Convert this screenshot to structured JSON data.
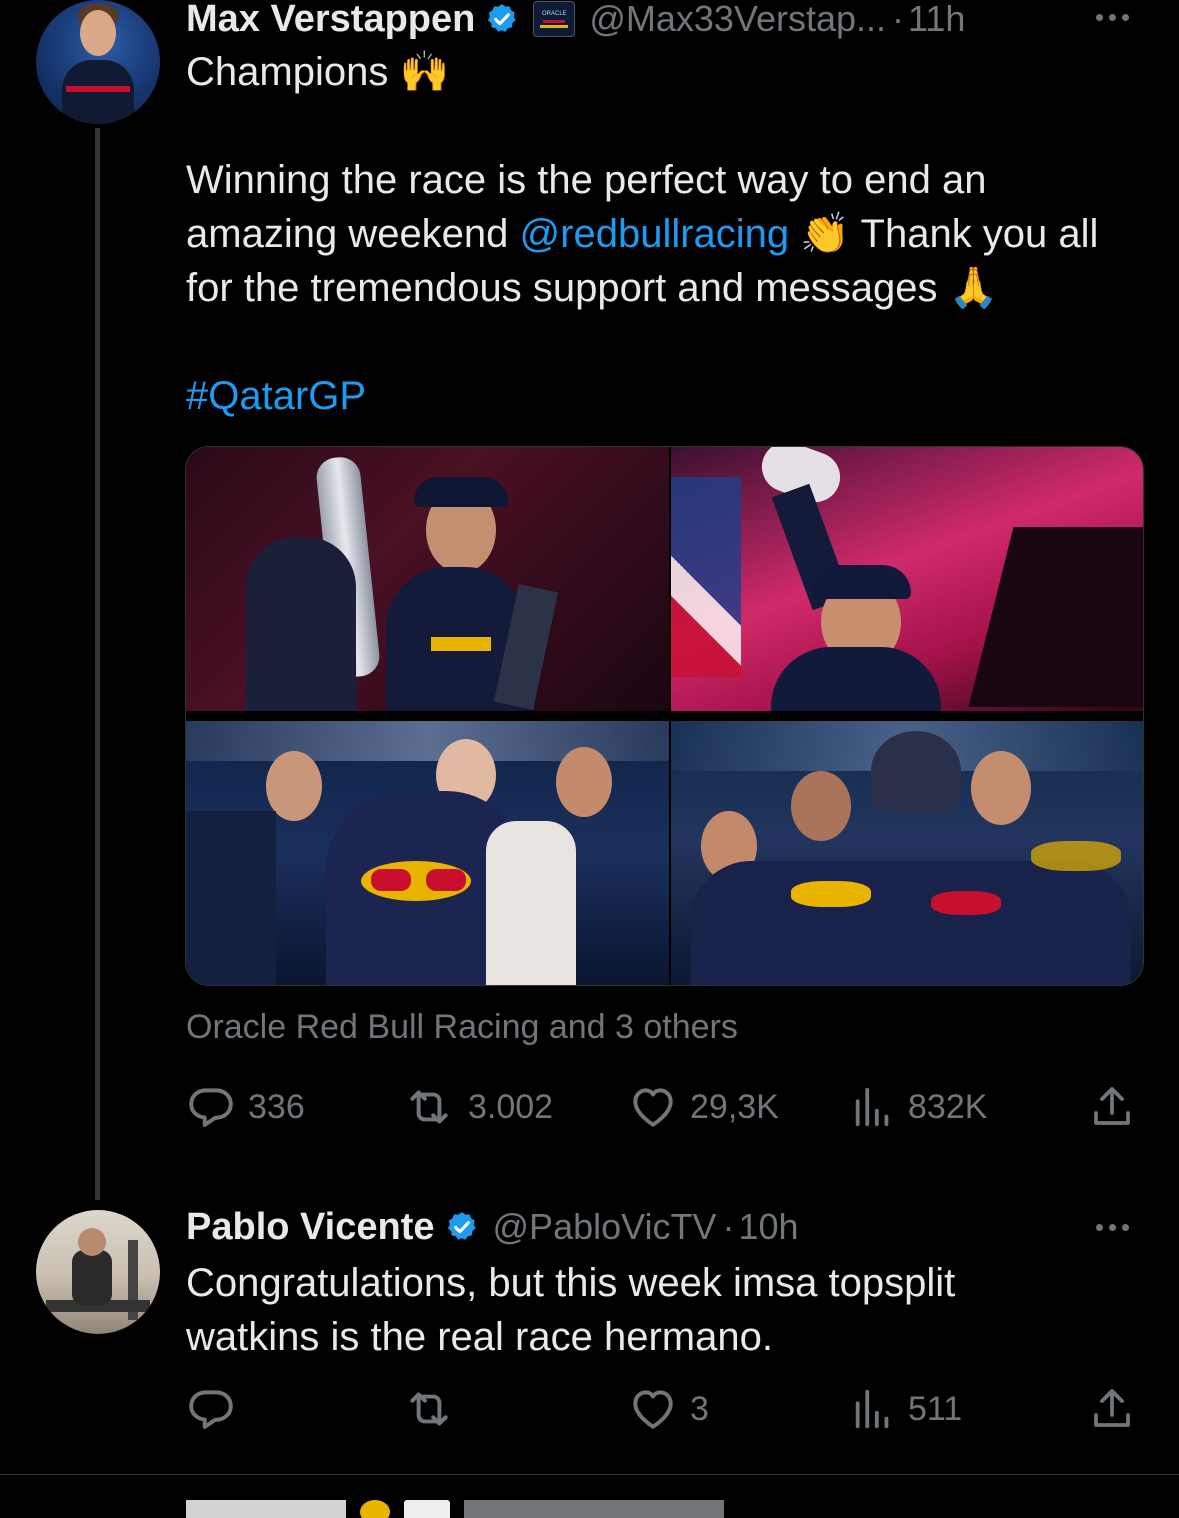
{
  "tweet1": {
    "author_name": "Max Verstappen",
    "author_handle": "@Max33Verstap...",
    "time": "11h",
    "affiliation_badge": "ORACLE",
    "line1": "Champions",
    "line1_emoji": "🙌",
    "para_part1": "Winning the race is the perfect way to end an amazing weekend ",
    "mention": "@redbullracing",
    "clap_emoji": "👏",
    "para_part2": " Thank you all for the tremendous support and messages ",
    "pray_emoji": "🙏",
    "hashtag": "#QatarGP",
    "liked_by": "Oracle Red Bull Racing and 3 others",
    "replies": "336",
    "reposts": "3.002",
    "likes": "29,3K",
    "views": "832K"
  },
  "tweet2": {
    "author_name": "Pablo Vicente",
    "author_handle": "@PabloVicTV",
    "time": "10h",
    "text": "Congratulations, but this week imsa topsplit watkins is the real race hermano.",
    "replies": "",
    "reposts": "",
    "likes": "3",
    "views": "511"
  },
  "colors": {
    "background": "#000000",
    "text": "#e7e9ea",
    "secondary": "#71767b",
    "link": "#1d9bf0",
    "verified": "#1d9bf0"
  },
  "icons": [
    "verified-icon",
    "more-icon",
    "reply-icon",
    "repost-icon",
    "like-icon",
    "views-icon",
    "share-icon"
  ]
}
